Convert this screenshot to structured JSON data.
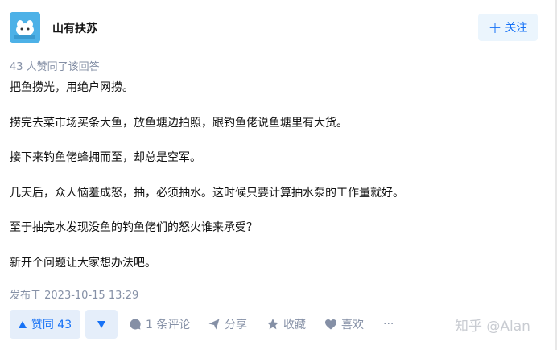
{
  "author": {
    "name": "山有扶苏"
  },
  "follow": {
    "label": "关注"
  },
  "voters": "43 人赞同了该回答",
  "paragraphs": [
    "把鱼捞光，用绝户网捞。",
    "捞完去菜市场买条大鱼，放鱼塘边拍照，跟钓鱼佬说鱼塘里有大货。",
    "接下来钓鱼佬蜂拥而至，却总是空军。",
    "几天后，众人恼羞成怒，抽，必须抽水。这时候只要计算抽水泵的工作量就好。",
    "至于抽完水发现没鱼的钓鱼佬们的怒火谁来承受？",
    "新开个问题让大家想办法吧。"
  ],
  "published": "发布于 2023-10-15 13:29",
  "actions": {
    "upvote_label": "赞同 43",
    "comment_label": "1 条评论",
    "share_label": "分享",
    "collect_label": "收藏",
    "like_label": "喜欢",
    "more_label": "···"
  },
  "watermark": "知乎 @Alan",
  "colors": {
    "accent": "#1772f6",
    "accent_bg": "#e5eefa",
    "muted": "#8590a6"
  },
  "icons": [
    "plus-icon",
    "triangle-up-icon",
    "triangle-down-icon",
    "comment-icon",
    "share-icon",
    "star-icon",
    "heart-icon",
    "more-icon"
  ]
}
